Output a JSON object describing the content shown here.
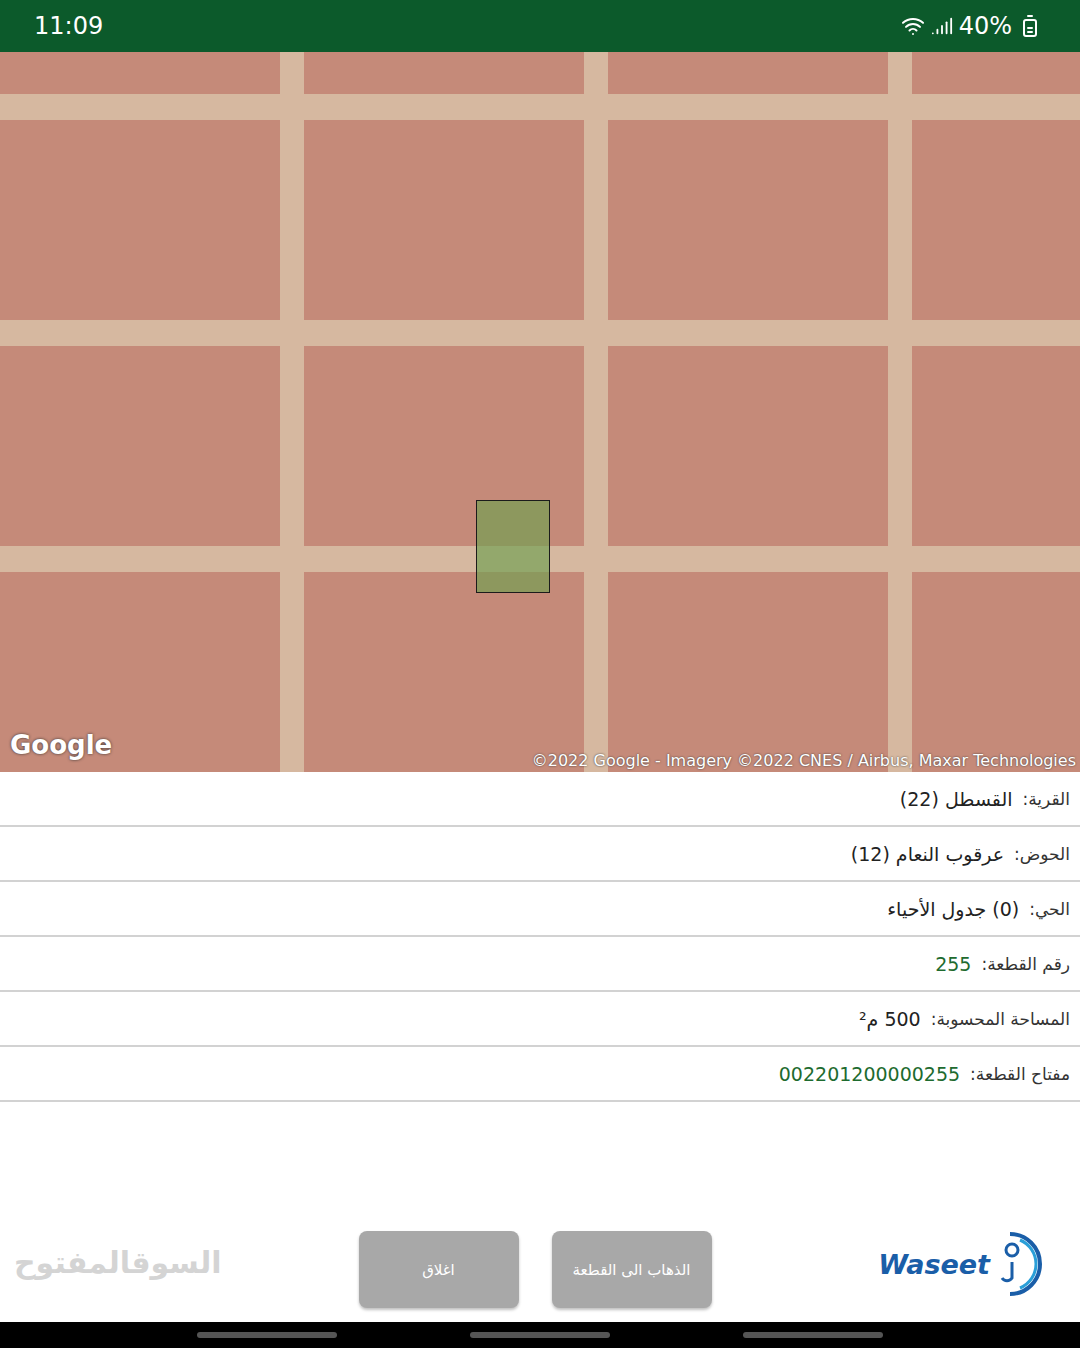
{
  "status_bar": {
    "time": "11:09",
    "battery": "40%"
  },
  "map": {
    "logo": "Google",
    "attribution": "©2022 Google - Imagery ©2022 CNES / Airbus, Maxar Technologies",
    "parcel_highlighted": true
  },
  "details": [
    {
      "label": "القرية:",
      "value": "القسطل (22)",
      "color": "#222222"
    },
    {
      "label": "الحوض:",
      "value": "عرقوب النعام (12)",
      "color": "#222222"
    },
    {
      "label": "الحي:",
      "value": "(0) جدول الأحياء",
      "color": "#222222"
    },
    {
      "label": "رقم القطعة:",
      "value": "255",
      "color": "#1e6b2f"
    },
    {
      "label": "المساحة المحسوبة:",
      "value": "500 م²",
      "color": "#222222"
    },
    {
      "label": "مفتاح القطعة:",
      "value": "002201200000255",
      "color": "#1e6b2f"
    }
  ],
  "buttons": [
    "اغلاق",
    "الذهاب الى القطعة"
  ],
  "logo": "Waseet",
  "watermark": "السوقالمفتوح"
}
